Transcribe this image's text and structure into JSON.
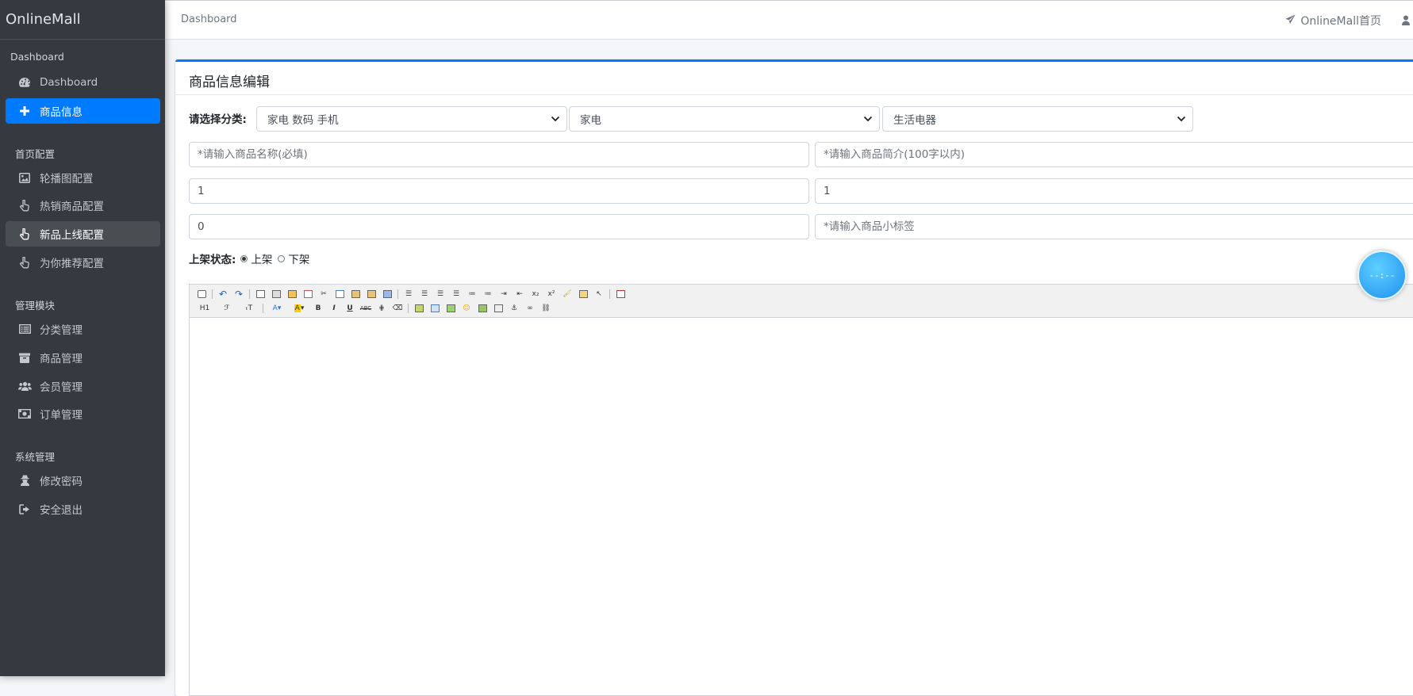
{
  "app": {
    "brand": "OnlineMall"
  },
  "sidebar": {
    "sections": [
      {
        "title": "Dashboard"
      },
      {
        "title": "首页配置"
      },
      {
        "title": "管理模块"
      },
      {
        "title": "系统管理"
      }
    ],
    "items": [
      {
        "label": "Dashboard",
        "icon": "dashboard-icon"
      },
      {
        "label": "商品信息",
        "icon": "plus-icon",
        "state": "active"
      },
      {
        "label": "轮播图配置",
        "icon": "image-icon"
      },
      {
        "label": "热销商品配置",
        "icon": "hand-pointer-icon"
      },
      {
        "label": "新品上线配置",
        "icon": "hand-pointer-icon",
        "state": "hover"
      },
      {
        "label": "为你推荐配置",
        "icon": "hand-pointer-icon"
      },
      {
        "label": "分类管理",
        "icon": "list-icon"
      },
      {
        "label": "商品管理",
        "icon": "archive-icon"
      },
      {
        "label": "会员管理",
        "icon": "users-icon"
      },
      {
        "label": "订单管理",
        "icon": "money-icon"
      },
      {
        "label": "修改密码",
        "icon": "user-secret-icon"
      },
      {
        "label": "安全退出",
        "icon": "sign-out-icon"
      }
    ]
  },
  "topbar": {
    "breadcrumb": "Dashboard",
    "home_link": "OnlineMall首页"
  },
  "form": {
    "title": "商品信息编辑",
    "category_label": "请选择分类:",
    "category_level1": "家电 数码 手机",
    "category_level2": "家电",
    "category_level3": "生活电器",
    "name_placeholder": "*请输入商品名称(必填)",
    "intro_placeholder": "*请输入商品简介(100字以内)",
    "original_price": "1",
    "selling_price": "1",
    "stock": "0",
    "tag_placeholder": "*请输入商品小标签",
    "status_label": "上架状态:",
    "status_on": "上架",
    "status_off": "下架",
    "status_selected": "上架"
  },
  "editor": {
    "heading_btn": "H1",
    "font_family_btn": "ℱ",
    "font_size_btn": "ₜT"
  },
  "floating_widget": {
    "text": "--:--"
  },
  "colors": {
    "sidebar_bg": "#343a40",
    "accent": "#007bff",
    "hover_bg": "#494e53"
  }
}
